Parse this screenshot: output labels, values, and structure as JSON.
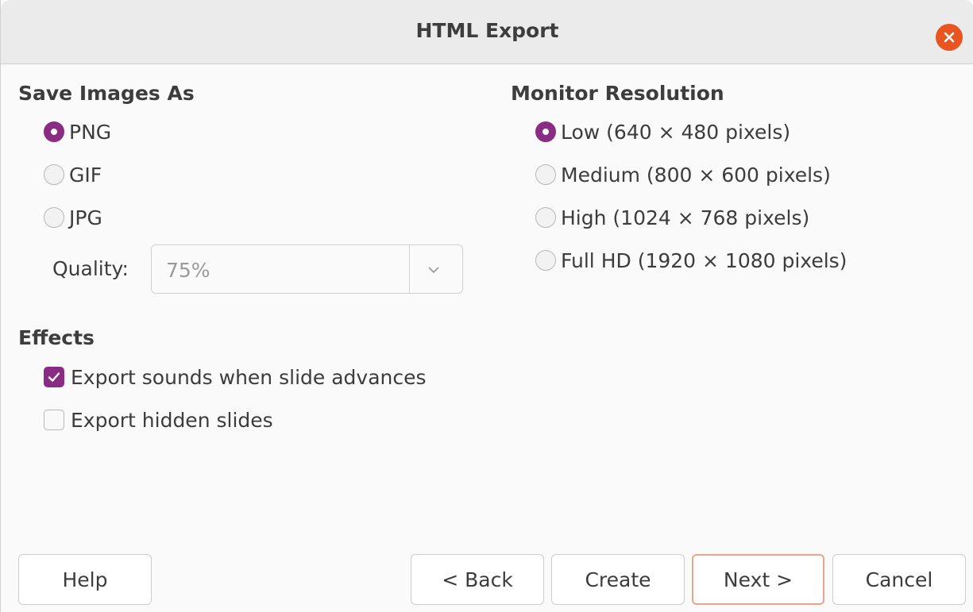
{
  "window": {
    "title": "HTML Export"
  },
  "save_images": {
    "heading": "Save Images As",
    "options": [
      {
        "label": "PNG",
        "selected": true
      },
      {
        "label": "GIF",
        "selected": false
      },
      {
        "label": "JPG",
        "selected": false
      }
    ],
    "quality_label": "Quality:",
    "quality_value": "75%"
  },
  "monitor": {
    "heading": "Monitor Resolution",
    "options": [
      {
        "label": "Low (640 × 480 pixels)",
        "selected": true
      },
      {
        "label": "Medium (800 × 600 pixels)",
        "selected": false
      },
      {
        "label": "High (1024 × 768 pixels)",
        "selected": false
      },
      {
        "label": "Full HD (1920 × 1080 pixels)",
        "selected": false
      }
    ]
  },
  "effects": {
    "heading": "Effects",
    "options": [
      {
        "label": "Export sounds when slide advances",
        "checked": true
      },
      {
        "label": "Export hidden slides",
        "checked": false
      }
    ]
  },
  "buttons": {
    "help": "Help",
    "back": "< Back",
    "create": "Create",
    "next": "Next >",
    "cancel": "Cancel"
  },
  "colors": {
    "accent": "#8b2c84",
    "close": "#e95420",
    "default_button_border": "#e9a48c"
  },
  "icons": {
    "close": "close-icon",
    "dropdown": "chevron-down-icon",
    "check": "checkmark-icon"
  }
}
